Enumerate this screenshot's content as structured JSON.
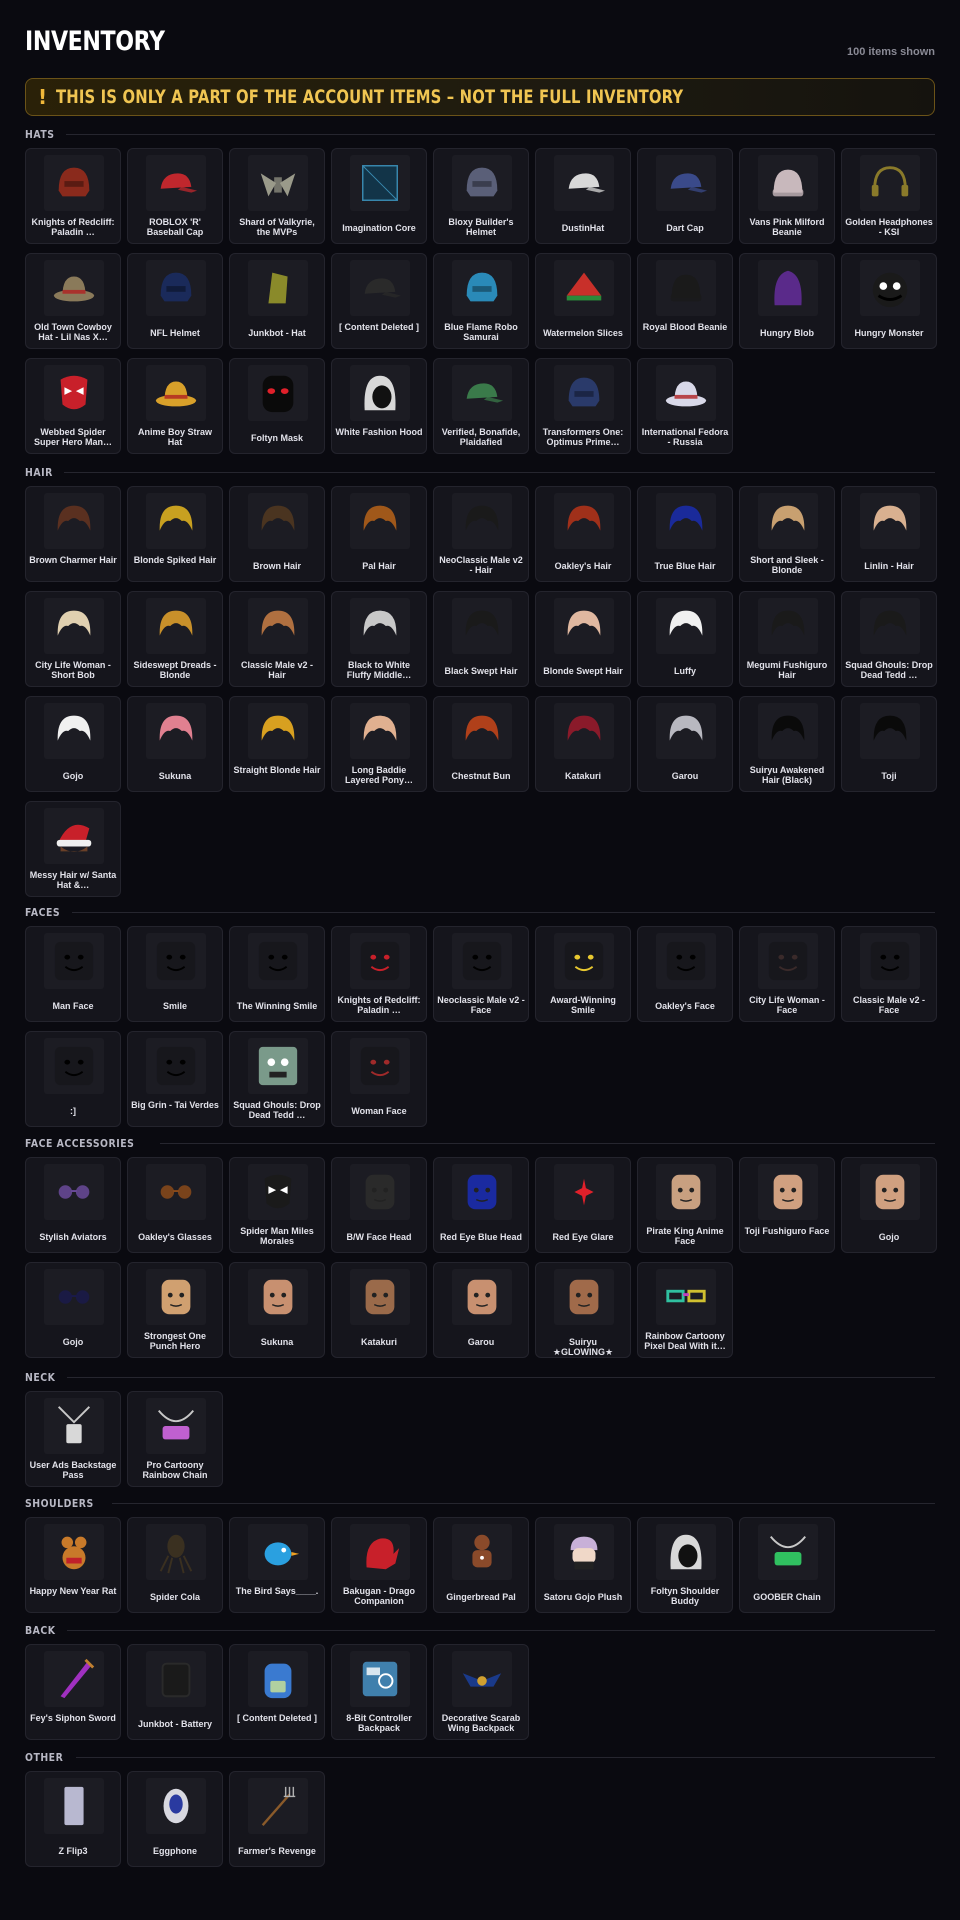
{
  "header": {
    "title": "INVENTORY",
    "count": "100 items shown"
  },
  "banner": {
    "icon": "!",
    "text": "THIS IS ONLY A PART OF THE ACCOUNT ITEMS – NOT THE FULL INVENTORY"
  },
  "sections": [
    {
      "title": "HATS",
      "items": [
        {
          "name": "Knights of Redcliff: Paladin …",
          "icon": "helmet-icon",
          "color": "#8a2a1c"
        },
        {
          "name": "ROBLOX 'R' Baseball Cap",
          "icon": "cap-icon",
          "color": "#c0272d"
        },
        {
          "name": "Shard of Valkyrie, the MVPs",
          "icon": "wings-icon",
          "color": "#9a9a8a"
        },
        {
          "name": "Imagination Core",
          "icon": "cube-icon",
          "color": "#123448"
        },
        {
          "name": "Bloxy Builder's Helmet",
          "icon": "helmet-icon",
          "color": "#5a5f78"
        },
        {
          "name": "DustinHat",
          "icon": "cap-icon",
          "color": "#d8d8d8"
        },
        {
          "name": "Dart Cap",
          "icon": "cap-icon",
          "color": "#3a4a8a"
        },
        {
          "name": "Vans Pink Milford Beanie",
          "icon": "beanie-icon",
          "color": "#c8b8bc"
        },
        {
          "name": "Golden Headphones - KSI",
          "icon": "headphones-icon",
          "color": "#8a7a2a"
        },
        {
          "name": "Old Town Cowboy Hat - Lil Nas X…",
          "icon": "cowboy-hat-icon",
          "color": "#8a7a5a"
        },
        {
          "name": "NFL Helmet",
          "icon": "helmet-icon",
          "color": "#1a2a5a"
        },
        {
          "name": "Junkbot - Hat",
          "icon": "hat-icon",
          "color": "#8a8a2a"
        },
        {
          "name": "[ Content Deleted ]",
          "icon": "cap-icon",
          "color": "#2a2a2a"
        },
        {
          "name": "Blue Flame Robo Samurai",
          "icon": "helmet-icon",
          "color": "#2a8ab8"
        },
        {
          "name": "Watermelon Slices",
          "icon": "watermelon-icon",
          "color": "#c8302a"
        },
        {
          "name": "Royal Blood Beanie",
          "icon": "beanie-icon",
          "color": "#1a1a1a"
        },
        {
          "name": "Hungry Blob",
          "icon": "blob-icon",
          "color": "#5a2a8a"
        },
        {
          "name": "Hungry Monster",
          "icon": "monster-face-icon",
          "color": "#1a1a1a"
        },
        {
          "name": "Webbed Spider Super Hero Man…",
          "icon": "spider-mask-icon",
          "color": "#c8202a"
        },
        {
          "name": "Anime Boy Straw Hat",
          "icon": "straw-hat-icon",
          "color": "#d8a02a"
        },
        {
          "name": "Foltyn Mask",
          "icon": "mask-icon",
          "color": "#0a0a0a"
        },
        {
          "name": "White Fashion Hood",
          "icon": "hood-icon",
          "color": "#d8d8d8"
        },
        {
          "name": "Verified, Bonafide, Plaidafied",
          "icon": "cap-icon",
          "color": "#3a7a4a"
        },
        {
          "name": "Transformers One: Optimus Prime…",
          "icon": "helmet-icon",
          "color": "#2a3a6a"
        },
        {
          "name": "International Fedora - Russia",
          "icon": "fedora-icon",
          "color": "#d8d8e8"
        }
      ]
    },
    {
      "title": "HAIR",
      "items": [
        {
          "name": "Brown Charmer Hair",
          "icon": "hair-icon",
          "color": "#5a3020"
        },
        {
          "name": "Blonde Spiked Hair",
          "icon": "hair-icon",
          "color": "#c8a020"
        },
        {
          "name": "Brown Hair",
          "icon": "hair-icon",
          "color": "#4a3420"
        },
        {
          "name": "Pal Hair",
          "icon": "hair-icon",
          "color": "#a0581a"
        },
        {
          "name": "NeoClassic Male v2 - Hair",
          "icon": "hair-icon",
          "color": "#1a1a1a"
        },
        {
          "name": "Oakley's Hair",
          "icon": "hair-icon",
          "color": "#a0301a"
        },
        {
          "name": "True Blue Hair",
          "icon": "hair-icon",
          "color": "#1a2a9a"
        },
        {
          "name": "Short and Sleek - Blonde",
          "icon": "hair-icon",
          "color": "#c8a070"
        },
        {
          "name": "Linlin - Hair",
          "icon": "hair-icon",
          "color": "#d8b090"
        },
        {
          "name": "City Life Woman - Short Bob",
          "icon": "hair-icon",
          "color": "#e0d0b0"
        },
        {
          "name": "Sideswept Dreads - Blonde",
          "icon": "hair-icon",
          "color": "#c8902a"
        },
        {
          "name": "Classic Male v2 - Hair",
          "icon": "hair-icon",
          "color": "#b07040"
        },
        {
          "name": "Black to White Fluffy Middle…",
          "icon": "hair-icon",
          "color": "#c8c8c8"
        },
        {
          "name": "Black Swept Hair",
          "icon": "hair-icon",
          "color": "#1a1a1a"
        },
        {
          "name": "Blonde Swept Hair",
          "icon": "hair-icon",
          "color": "#e0b8a0"
        },
        {
          "name": "Luffy",
          "icon": "hair-icon",
          "color": "#f0f0f0"
        },
        {
          "name": "Megumi Fushiguro Hair",
          "icon": "hair-icon",
          "color": "#1a1a1a"
        },
        {
          "name": "Squad Ghouls: Drop Dead Tedd …",
          "icon": "hair-icon",
          "color": "#1a1a1a"
        },
        {
          "name": "Gojo",
          "icon": "hair-icon",
          "color": "#f0f0f0"
        },
        {
          "name": "Sukuna",
          "icon": "hair-icon",
          "color": "#e08090"
        },
        {
          "name": "Straight Blonde Hair",
          "icon": "hair-icon",
          "color": "#d8a020"
        },
        {
          "name": "Long Baddie Layered Pony…",
          "icon": "hair-icon",
          "color": "#e0b090"
        },
        {
          "name": "Chestnut Bun",
          "icon": "hair-icon",
          "color": "#b0401a"
        },
        {
          "name": "Katakuri",
          "icon": "hair-icon",
          "color": "#8a1a2a"
        },
        {
          "name": "Garou",
          "icon": "hair-icon",
          "color": "#b8b8c0"
        },
        {
          "name": "Suiryu Awakened Hair (Black)",
          "icon": "hair-icon",
          "color": "#0a0a0a"
        },
        {
          "name": "Toji",
          "icon": "hair-icon",
          "color": "#0a0a0a"
        },
        {
          "name": "Messy Hair w/ Santa Hat &…",
          "icon": "santa-hat-icon",
          "color": "#c8202a"
        }
      ]
    },
    {
      "title": "FACES",
      "items": [
        {
          "name": "Man Face",
          "icon": "face-icon",
          "color": "#000000"
        },
        {
          "name": "Smile",
          "icon": "face-icon",
          "color": "#000000"
        },
        {
          "name": "The Winning Smile",
          "icon": "face-icon",
          "color": "#000000"
        },
        {
          "name": "Knights of Redcliff: Paladin …",
          "icon": "face-icon",
          "color": "#c8202a"
        },
        {
          "name": "Neoclassic Male v2 - Face",
          "icon": "face-icon",
          "color": "#000000"
        },
        {
          "name": "Award-Winning Smile",
          "icon": "face-icon",
          "color": "#e8c830"
        },
        {
          "name": "Oakley's Face",
          "icon": "face-icon",
          "color": "#000000"
        },
        {
          "name": "City Life Woman - Face",
          "icon": "face-icon",
          "color": "#3a2a2a"
        },
        {
          "name": "Classic Male v2 - Face",
          "icon": "face-icon",
          "color": "#000000"
        },
        {
          "name": ":]",
          "icon": "face-icon",
          "color": "#000000"
        },
        {
          "name": "Big Grin - Tai Verdes",
          "icon": "face-icon",
          "color": "#000000"
        },
        {
          "name": "Squad Ghouls: Drop Dead Tedd …",
          "icon": "zombie-face-icon",
          "color": "#7a9a8a"
        },
        {
          "name": "Woman Face",
          "icon": "face-icon",
          "color": "#a02a2a"
        }
      ]
    },
    {
      "title": "FACE ACCESSORIES",
      "items": [
        {
          "name": "Stylish Aviators",
          "icon": "glasses-icon",
          "color": "#6a4a9a"
        },
        {
          "name": "Oakley's Glasses",
          "icon": "glasses-icon",
          "color": "#8a4a1a"
        },
        {
          "name": "Spider Man Miles Morales",
          "icon": "spider-mask-icon",
          "color": "#1a1a1a"
        },
        {
          "name": "B/W Face Head",
          "icon": "head-icon",
          "color": "#2a2a2a"
        },
        {
          "name": "Red Eye Blue Head",
          "icon": "head-icon",
          "color": "#1a2aa0"
        },
        {
          "name": "Red Eye Glare",
          "icon": "glare-icon",
          "color": "#e0202a"
        },
        {
          "name": "Pirate King Anime Face",
          "icon": "head-icon",
          "color": "#c8a080"
        },
        {
          "name": "Toji Fushiguro Face",
          "icon": "head-icon",
          "color": "#d0a080"
        },
        {
          "name": "Gojo",
          "icon": "head-icon",
          "color": "#d0a080"
        },
        {
          "name": "Gojo",
          "icon": "glasses-icon",
          "color": "#1a1a4a"
        },
        {
          "name": "Strongest One Punch Hero",
          "icon": "head-icon",
          "color": "#d0a070"
        },
        {
          "name": "Sukuna",
          "icon": "head-icon",
          "color": "#c89070"
        },
        {
          "name": "Katakuri",
          "icon": "head-icon",
          "color": "#9a6a4a"
        },
        {
          "name": "Garou",
          "icon": "head-icon",
          "color": "#c89070"
        },
        {
          "name": "Suiryu ★GLOWING★",
          "icon": "head-icon",
          "color": "#a06a4a"
        },
        {
          "name": "Rainbow Cartoony Pixel Deal With it…",
          "icon": "pixel-glasses-icon",
          "color": "#30c0a0"
        }
      ]
    },
    {
      "title": "NECK",
      "items": [
        {
          "name": "User Ads Backstage Pass",
          "icon": "lanyard-icon",
          "color": "#c8c8c8"
        },
        {
          "name": "Pro Cartoony Rainbow Chain",
          "icon": "chain-icon",
          "color": "#c060d0"
        }
      ]
    },
    {
      "title": "SHOULDERS",
      "items": [
        {
          "name": "Happy New Year Rat",
          "icon": "rat-icon",
          "color": "#c87a2a"
        },
        {
          "name": "Spider Cola",
          "icon": "spider-icon",
          "color": "#3a3020"
        },
        {
          "name": "The Bird Says____.",
          "icon": "bird-icon",
          "color": "#2aa0e0"
        },
        {
          "name": "Bakugan - Drago Companion",
          "icon": "dragon-icon",
          "color": "#c8202a"
        },
        {
          "name": "Gingerbread Pal",
          "icon": "gingerbread-icon",
          "color": "#8a4a2a"
        },
        {
          "name": "Satoru Gojo Plush",
          "icon": "plush-icon",
          "color": "#c8b0d8"
        },
        {
          "name": "Foltyn Shoulder Buddy",
          "icon": "hood-icon",
          "color": "#d8d8d8"
        },
        {
          "name": "GOOBER Chain",
          "icon": "chain-icon",
          "color": "#30c060"
        }
      ]
    },
    {
      "title": "BACK",
      "items": [
        {
          "name": "Fey's Siphon Sword",
          "icon": "sword-icon",
          "color": "#a030c0"
        },
        {
          "name": "Junkbot - Battery",
          "icon": "battery-icon",
          "color": "#1a1a1a"
        },
        {
          "name": "[ Content Deleted ]",
          "icon": "backpack-icon",
          "color": "#3a7ad0"
        },
        {
          "name": "8-Bit Controller Backpack",
          "icon": "controller-icon",
          "color": "#4a9ad0"
        },
        {
          "name": "Decorative Scarab Wing Backpack",
          "icon": "scarab-icon",
          "color": "#1a3a8a"
        }
      ]
    },
    {
      "title": "OTHER",
      "items": [
        {
          "name": "Z Flip3",
          "icon": "phone-icon",
          "color": "#b8b8d0"
        },
        {
          "name": "Eggphone",
          "icon": "egg-phone-icon",
          "color": "#d8d8e0"
        },
        {
          "name": "Farmer's Revenge",
          "icon": "pitchfork-icon",
          "color": "#8a5a2a"
        }
      ]
    }
  ]
}
